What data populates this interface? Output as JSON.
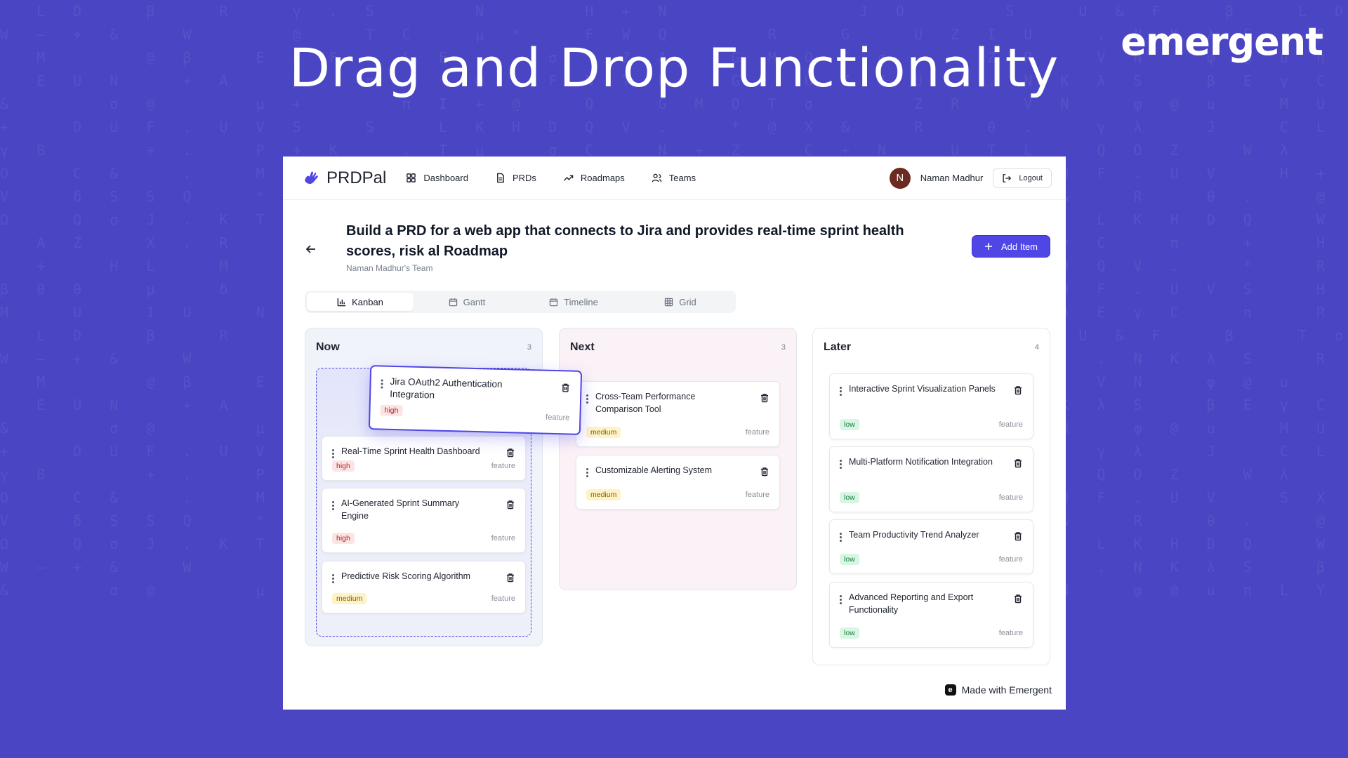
{
  "slide": {
    "headline": "Drag and Drop Functionality",
    "brand": "emergent"
  },
  "nav": {
    "logo": "PRDPal",
    "items": [
      {
        "label": "Dashboard",
        "icon": "dashboard-grid-icon"
      },
      {
        "label": "PRDs",
        "icon": "document-icon"
      },
      {
        "label": "Roadmaps",
        "icon": "trending-up-icon"
      },
      {
        "label": "Teams",
        "icon": "users-icon"
      }
    ],
    "avatar_initial": "N",
    "user_name": "Naman Madhur",
    "logout_label": "Logout"
  },
  "page": {
    "title": "Build a PRD for a web app that connects to Jira and provides real-time sprint health scores, risk al Roadmap",
    "subtitle": "Naman Madhur's Team",
    "add_item_label": "Add Item"
  },
  "view_tabs": [
    {
      "label": "Kanban",
      "icon": "bar-chart-icon",
      "active": true
    },
    {
      "label": "Gantt",
      "icon": "calendar-icon",
      "active": false
    },
    {
      "label": "Timeline",
      "icon": "calendar-icon",
      "active": false
    },
    {
      "label": "Grid",
      "icon": "grid-icon",
      "active": false
    }
  ],
  "columns": [
    {
      "title": "Now",
      "count": "3",
      "dragging_card": {
        "title": "Jira OAuth2 Authentication Integration",
        "priority": "high",
        "type": "feature"
      },
      "cards": [
        {
          "title": "Real-Time Sprint Health Dashboard",
          "priority": "high",
          "type": "feature"
        },
        {
          "title": "AI-Generated Sprint Summary Engine",
          "priority": "high",
          "type": "feature"
        },
        {
          "title": "Predictive Risk Scoring Algorithm",
          "priority": "medium",
          "type": "feature"
        }
      ]
    },
    {
      "title": "Next",
      "count": "3",
      "cards": [
        {
          "title": "Cross-Team Performance Comparison Tool",
          "priority": "medium",
          "type": "feature"
        },
        {
          "title": "Customizable Alerting System",
          "priority": "medium",
          "type": "feature"
        }
      ]
    },
    {
      "title": "Later",
      "count": "4",
      "cards": [
        {
          "title": "Interactive Sprint Visualization Panels",
          "priority": "low",
          "type": "feature"
        },
        {
          "title": "Multi-Platform Notification Integration",
          "priority": "low",
          "type": "feature"
        },
        {
          "title": "Team Productivity Trend Analyzer",
          "priority": "low",
          "type": "feature"
        },
        {
          "title": "Advanced Reporting and Export Functionality",
          "priority": "low",
          "type": "feature"
        }
      ]
    }
  ],
  "footer": {
    "made_with": "Made with Emergent"
  },
  "colors": {
    "background": "#4a45c2",
    "accent": "#4f46e5"
  }
}
